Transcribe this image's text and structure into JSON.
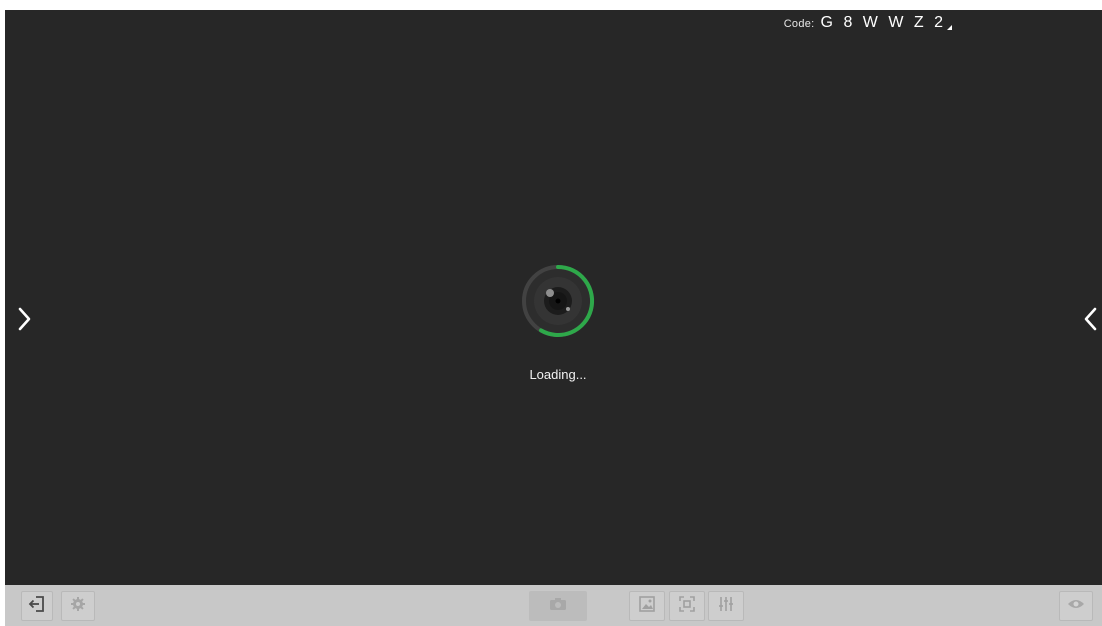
{
  "header": {
    "code_label": "Code:",
    "code_value": "G 8 W W Z 2"
  },
  "loading": {
    "text": "Loading...",
    "accent_color": "#2ea84a"
  },
  "navigation": {
    "left_arrow_icon": "chevron-right-icon",
    "right_arrow_icon": "chevron-left-icon"
  },
  "toolbar": {
    "buttons": [
      {
        "id": "exit",
        "icon": "exit-icon"
      },
      {
        "id": "settings",
        "icon": "gear-icon"
      },
      {
        "id": "capture",
        "icon": "camera-icon"
      },
      {
        "id": "image",
        "icon": "image-icon"
      },
      {
        "id": "fit",
        "icon": "fit-screen-icon"
      },
      {
        "id": "adjust",
        "icon": "sliders-icon"
      },
      {
        "id": "preview",
        "icon": "eye-icon"
      }
    ]
  },
  "colors": {
    "viewport_bg": "#272727",
    "toolbar_bg": "#c8c8c8"
  }
}
